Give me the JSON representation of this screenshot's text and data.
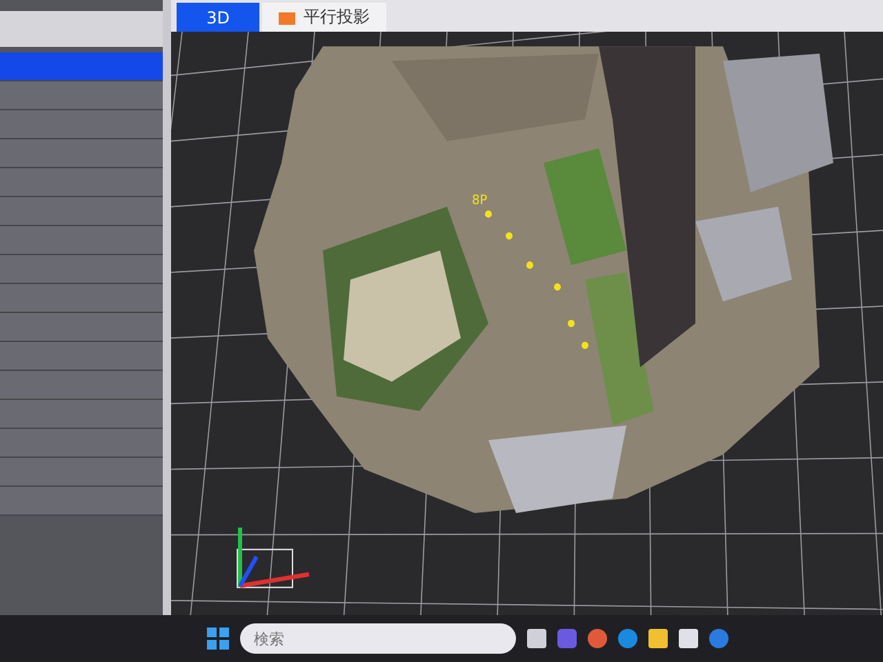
{
  "viewer": {
    "tabs": [
      {
        "label": "3D",
        "selected": true,
        "kind": "plain"
      },
      {
        "label": "平行投影",
        "selected": false,
        "kind": "icon"
      }
    ],
    "marker_label": "8P"
  },
  "layer_panel": {
    "rows": [
      {
        "selected": true
      },
      {
        "selected": false
      },
      {
        "selected": false
      },
      {
        "selected": false
      },
      {
        "selected": false
      },
      {
        "selected": false
      },
      {
        "selected": false
      },
      {
        "selected": false
      },
      {
        "selected": false
      },
      {
        "selected": false
      },
      {
        "selected": false
      },
      {
        "selected": false
      },
      {
        "selected": false
      },
      {
        "selected": false
      },
      {
        "selected": false
      },
      {
        "selected": false
      }
    ]
  },
  "taskbar": {
    "search": {
      "placeholder": "検索"
    }
  }
}
